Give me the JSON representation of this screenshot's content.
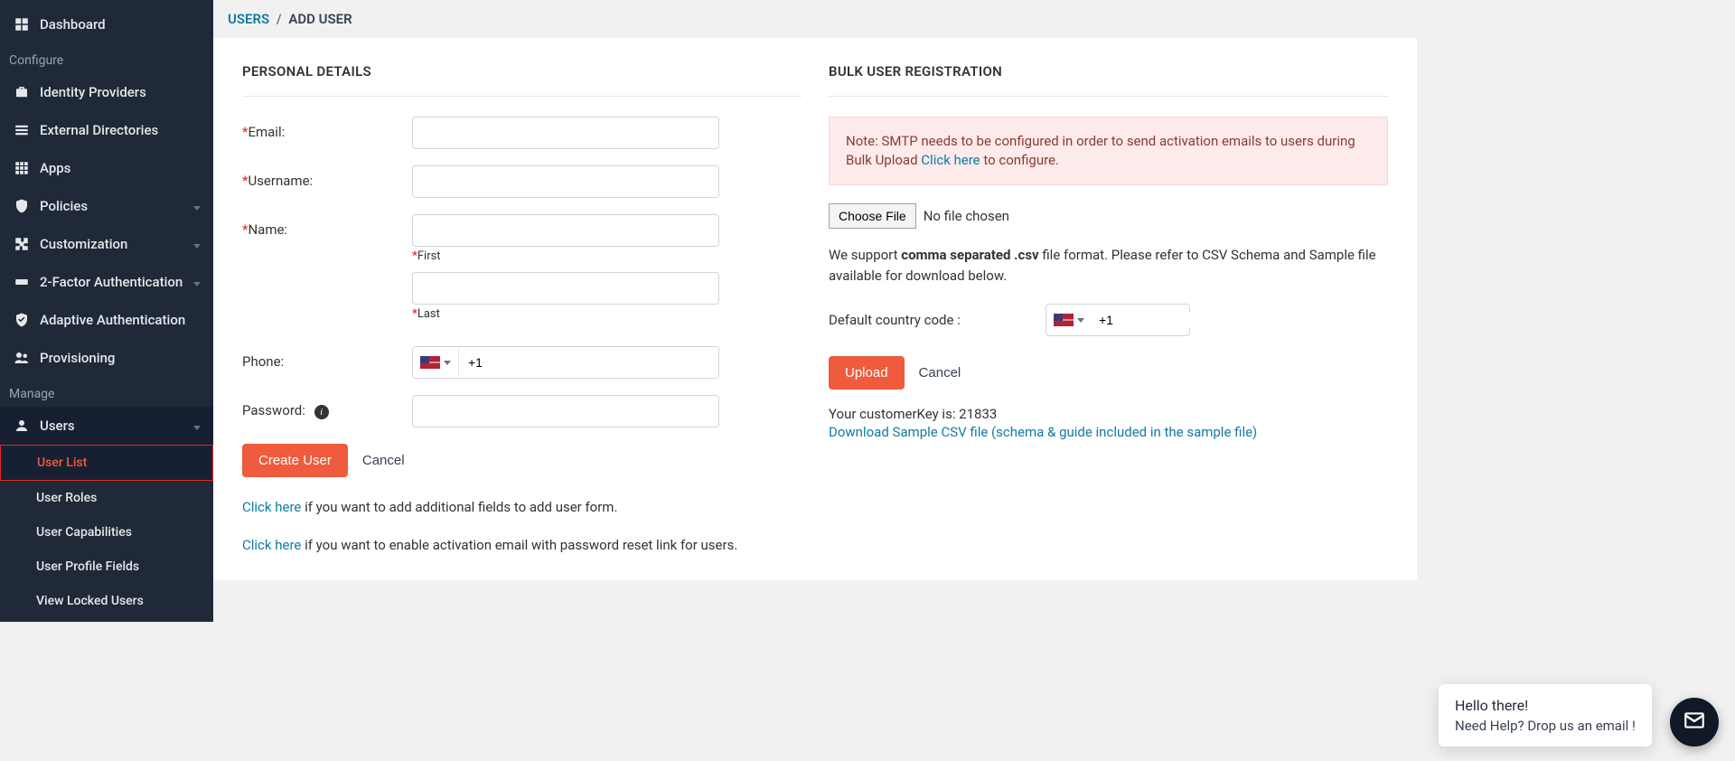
{
  "sidebar": {
    "dashboard": "Dashboard",
    "section_configure": "Configure",
    "identity_providers": "Identity Providers",
    "external_directories": "External Directories",
    "apps": "Apps",
    "policies": "Policies",
    "customization": "Customization",
    "twofactor": "2-Factor Authentication",
    "adaptive": "Adaptive Authentication",
    "provisioning": "Provisioning",
    "section_manage": "Manage",
    "users": "Users",
    "users_children": {
      "user_list": "User List",
      "user_roles": "User Roles",
      "user_capabilities": "User Capabilities",
      "user_profile_fields": "User Profile Fields",
      "view_locked_users": "View Locked Users"
    }
  },
  "breadcrumb": {
    "users": "USERS",
    "sep": "/",
    "current": "ADD USER"
  },
  "left": {
    "heading": "PERSONAL DETAILS",
    "email_label": "Email:",
    "username_label": "Username:",
    "name_label": "Name:",
    "first": "First",
    "last": "Last",
    "phone_label": "Phone:",
    "phone_prefix": "+1",
    "password_label": "Password:",
    "create_btn": "Create User",
    "cancel_btn": "Cancel",
    "hint1_link": "Click here",
    "hint1_rest": " if you want to add additional fields to add user form.",
    "hint2_link": "Click here",
    "hint2_rest": " if you want to enable activation email with password reset link for users."
  },
  "right": {
    "heading": "BULK USER REGISTRATION",
    "alert_pre": "Note: SMTP needs to be configured in order to send activation emails to users during Bulk Upload ",
    "alert_link": "Click here",
    "alert_post": " to configure.",
    "choose_file": "Choose File",
    "no_file": "No file chosen",
    "support_pre": "We support ",
    "support_bold": "comma separated .csv",
    "support_post": " file format. Please refer to CSV Schema and Sample file available for download below.",
    "cc_label": "Default country code :",
    "cc_value": "+1",
    "upload_btn": "Upload",
    "cancel_btn": "Cancel",
    "cust_key_label": "Your customerKey is: ",
    "cust_key_value": "21833",
    "download_link": "Download Sample CSV file (schema & guide included in the sample file)"
  },
  "chat": {
    "line1": "Hello there!",
    "line2": "Need Help? Drop us an email !"
  }
}
